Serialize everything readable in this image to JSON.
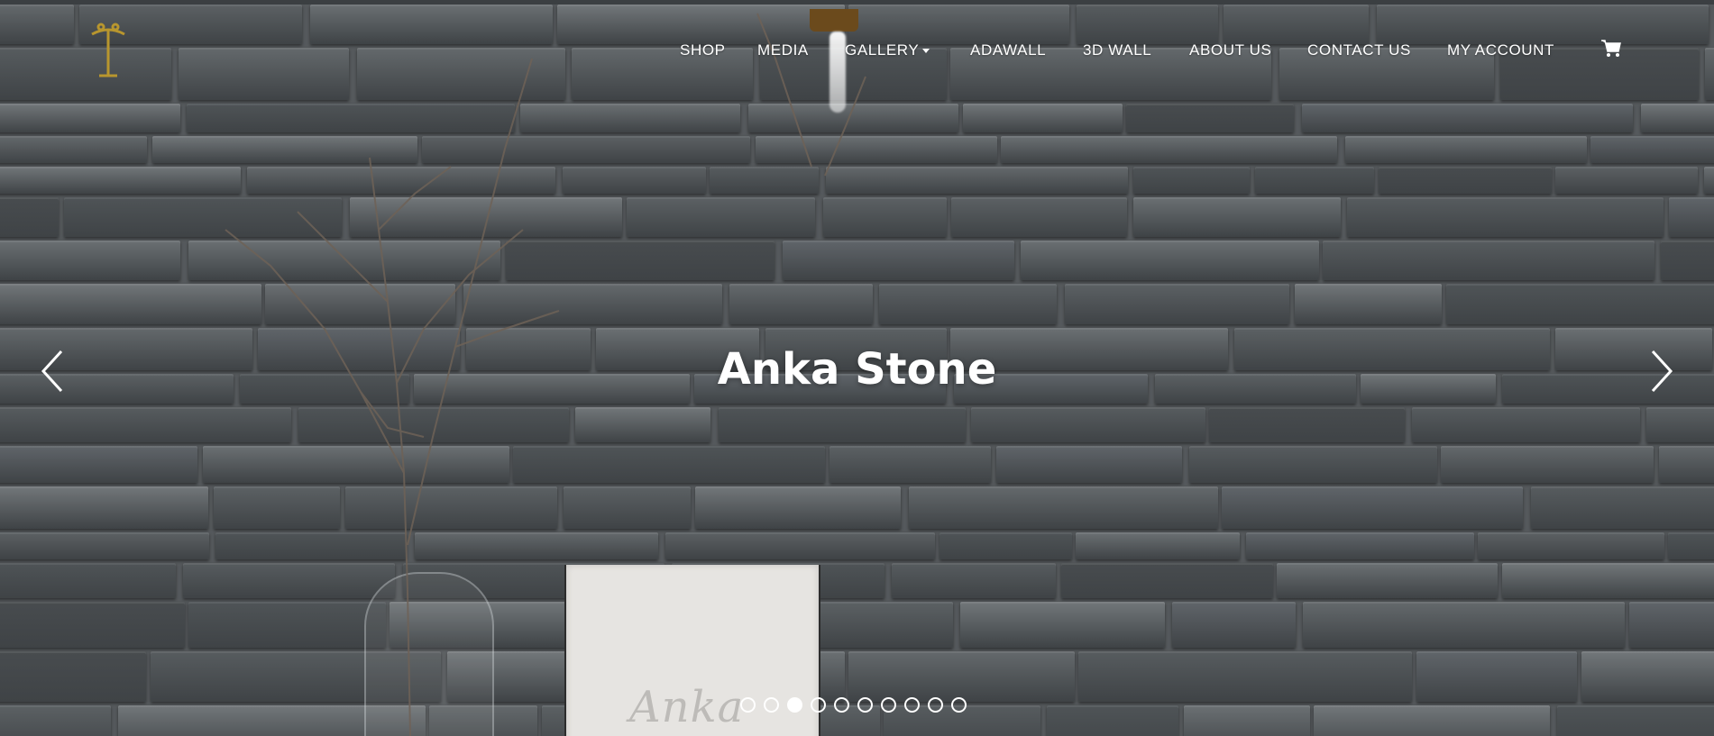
{
  "brand": {
    "logo_icon": "gold-t-monogram-logo",
    "logo_color": "#b8962e"
  },
  "nav": {
    "items": [
      {
        "label": "SHOP"
      },
      {
        "label": "MEDIA"
      },
      {
        "label": "GALLERY",
        "has_dropdown": true
      },
      {
        "label": "ADAWALL"
      },
      {
        "label": "3D WALL"
      },
      {
        "label": "ABOUT US"
      },
      {
        "label": "CONTACT US"
      },
      {
        "label": "MY ACCOUNT"
      }
    ],
    "cart_icon": "shopping-cart-icon"
  },
  "slider": {
    "title": "Anka Stone",
    "prev_icon": "chevron-left-icon",
    "next_icon": "chevron-right-icon",
    "indicator_count": 10,
    "active_index": 2,
    "image_text": "Anka"
  },
  "colors": {
    "text": "#ffffff",
    "overlay": "#55595c"
  }
}
